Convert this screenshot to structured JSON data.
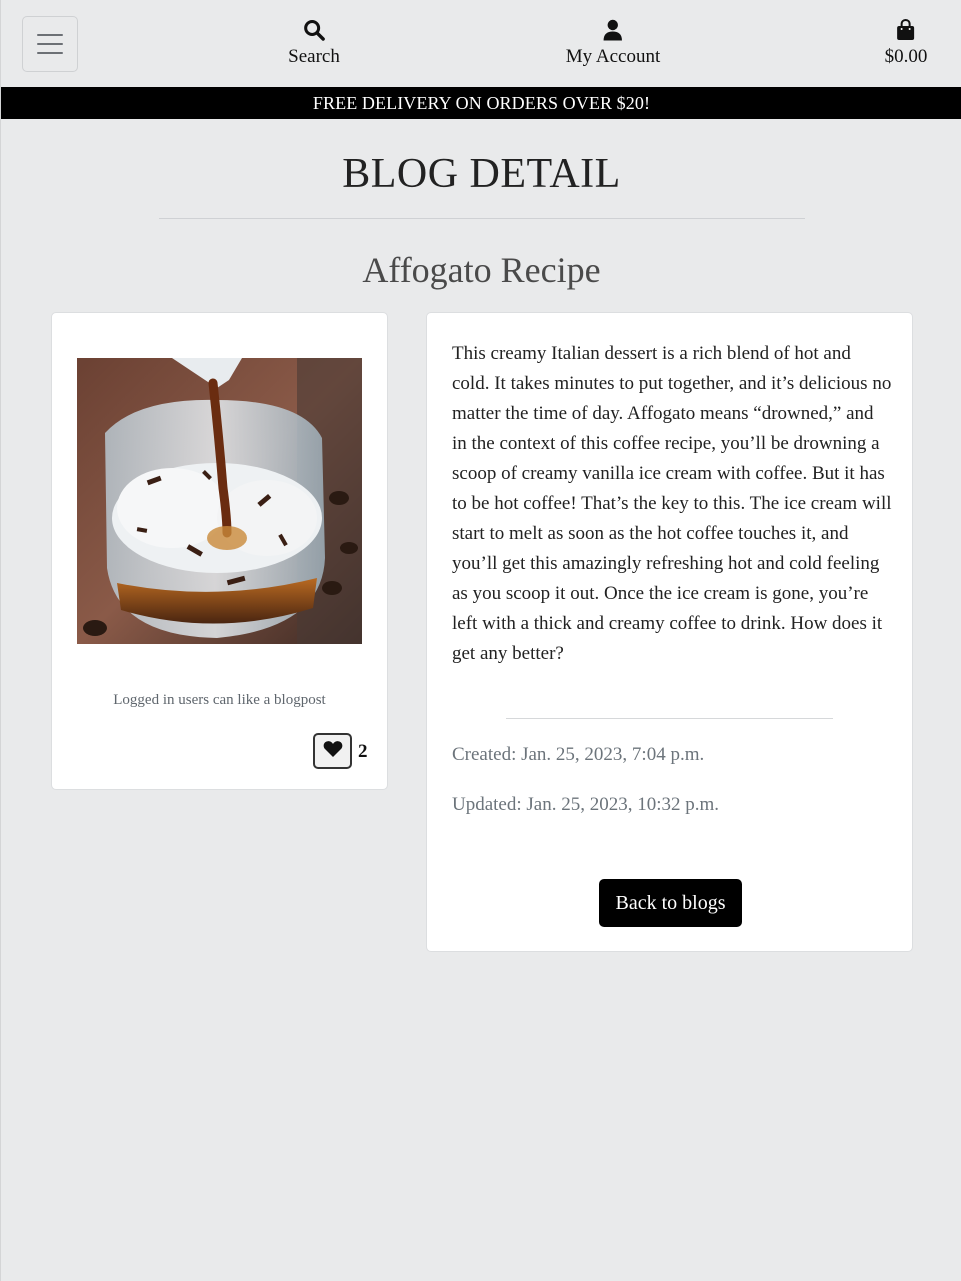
{
  "header": {
    "menu_icon": "hamburger-icon",
    "search": {
      "label": "Search",
      "icon": "search-icon"
    },
    "account": {
      "label": "My Account",
      "icon": "user-icon"
    },
    "bag": {
      "label": "$0.00",
      "icon": "shopping-bag-icon"
    }
  },
  "banner": {
    "text": "FREE DELIVERY ON ORDERS OVER $20!"
  },
  "page": {
    "title": "BLOG DETAIL"
  },
  "post": {
    "title": "Affogato Recipe",
    "image_alt": "Affogato",
    "like_note": "Logged in users can like a blogpost",
    "like_count": "2",
    "body": "This creamy Italian dessert is a rich blend of hot and cold. It takes minutes to put together, and it’s delicious no matter the time of day. Affogato means “drowned,” and in the context of this coffee recipe, you’ll be drowning a scoop of creamy vanilla ice cream with coffee. But it has to be hot coffee! That’s the key to this. The ice cream will start to melt as soon as the hot coffee touches it, and you’ll get this amazingly refreshing hot and cold feeling as you scoop it out. Once the ice cream is gone, you’re left with a thick and creamy coffee to drink. How does it get any better?",
    "created": "Created: Jan. 25, 2023, 7:04 p.m.",
    "updated": "Updated: Jan. 25, 2023, 10:32 p.m.",
    "back_label": "Back to blogs"
  },
  "colors": {
    "background": "#e9eaeb",
    "banner": "#000000",
    "card": "#ffffff",
    "button": "#000000"
  }
}
